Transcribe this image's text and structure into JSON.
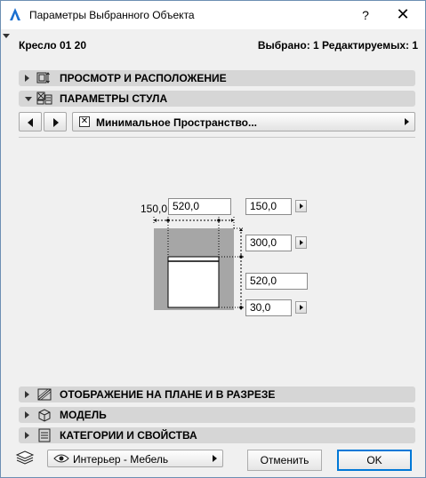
{
  "window": {
    "title": "Параметры Выбранного Объекта",
    "help_label": "?",
    "close_label": "✕"
  },
  "header": {
    "object_name": "Кресло 01 20",
    "selection_info": "Выбрано: 1 Редактируемых: 1"
  },
  "panels": {
    "preview": {
      "label": "ПРОСМОТР И РАСПОЛОЖЕНИЕ",
      "icon": "preview-icon",
      "expanded": false
    },
    "params": {
      "label": "ПАРАМЕТРЫ СТУЛА",
      "icon": "chair-params-icon",
      "expanded": true
    },
    "floorplan": {
      "label": "ОТОБРАЖЕНИЕ НА ПЛАНЕ И В РАЗРЕЗЕ",
      "icon": "floorplan-icon",
      "expanded": false
    },
    "model": {
      "label": "МОДЕЛЬ",
      "icon": "cube-icon",
      "expanded": false
    },
    "categories": {
      "label": "КАТЕГОРИИ И СВОЙСТВА",
      "icon": "list-icon",
      "expanded": false
    }
  },
  "page_nav": {
    "current_page": "Минимальное Пространство..."
  },
  "dimensions": {
    "left_clearance_label": "150,0",
    "width_value": "520,0",
    "right_clearance_value": "150,0",
    "back_clearance_value": "300,0",
    "depth_value": "520,0",
    "front_clearance_value": "30,0"
  },
  "footer": {
    "layer": "Интерьер - Мебель",
    "cancel_label": "Отменить",
    "ok_label": "OK"
  },
  "colors": {
    "panel_bar": "#d6d6d6",
    "clearance_area": "#a6a6a6",
    "accent": "#0078d7"
  }
}
